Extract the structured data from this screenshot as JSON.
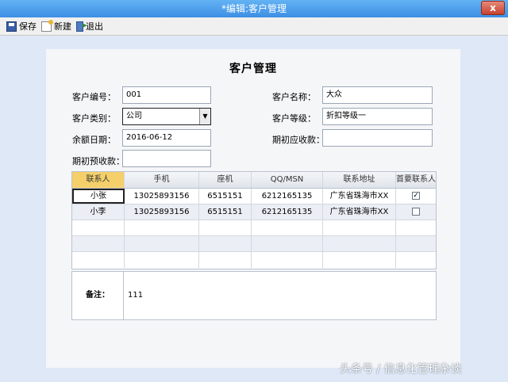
{
  "window": {
    "title": "*编辑:客户管理",
    "close_label": "x"
  },
  "toolbar": {
    "save": "保存",
    "new": "新建",
    "exit": "退出"
  },
  "form": {
    "title": "客户管理",
    "code_label": "客户编号：",
    "code_value": "001",
    "name_label": "客户名称：",
    "name_value": "大众",
    "type_label": "客户类别：",
    "type_value": "公司",
    "level_label": "客户等级：",
    "level_value": "折扣等级一",
    "date_label": "余额日期：",
    "date_value": "2016-06-12",
    "receivable_label": "期初应收款：",
    "receivable_value": "",
    "prepaid_label": "期初预收款：",
    "prepaid_value": ""
  },
  "contacts": {
    "headers": [
      "联系人",
      "手机",
      "座机",
      "QQ/MSN",
      "联系地址",
      "首要联系人"
    ],
    "rows": [
      {
        "name": "小张",
        "mobile": "13025893156",
        "phone": "6515151",
        "qq": "6212165135",
        "address": "广东省珠海市XX",
        "primary": true
      },
      {
        "name": "小李",
        "mobile": "13025893156",
        "phone": "6515151",
        "qq": "6212165135",
        "address": "广东省珠海市XX",
        "primary": false
      }
    ]
  },
  "notes": {
    "label": "备注：",
    "value": "111"
  },
  "watermark": "头条号 / 信息化管理杂谈"
}
